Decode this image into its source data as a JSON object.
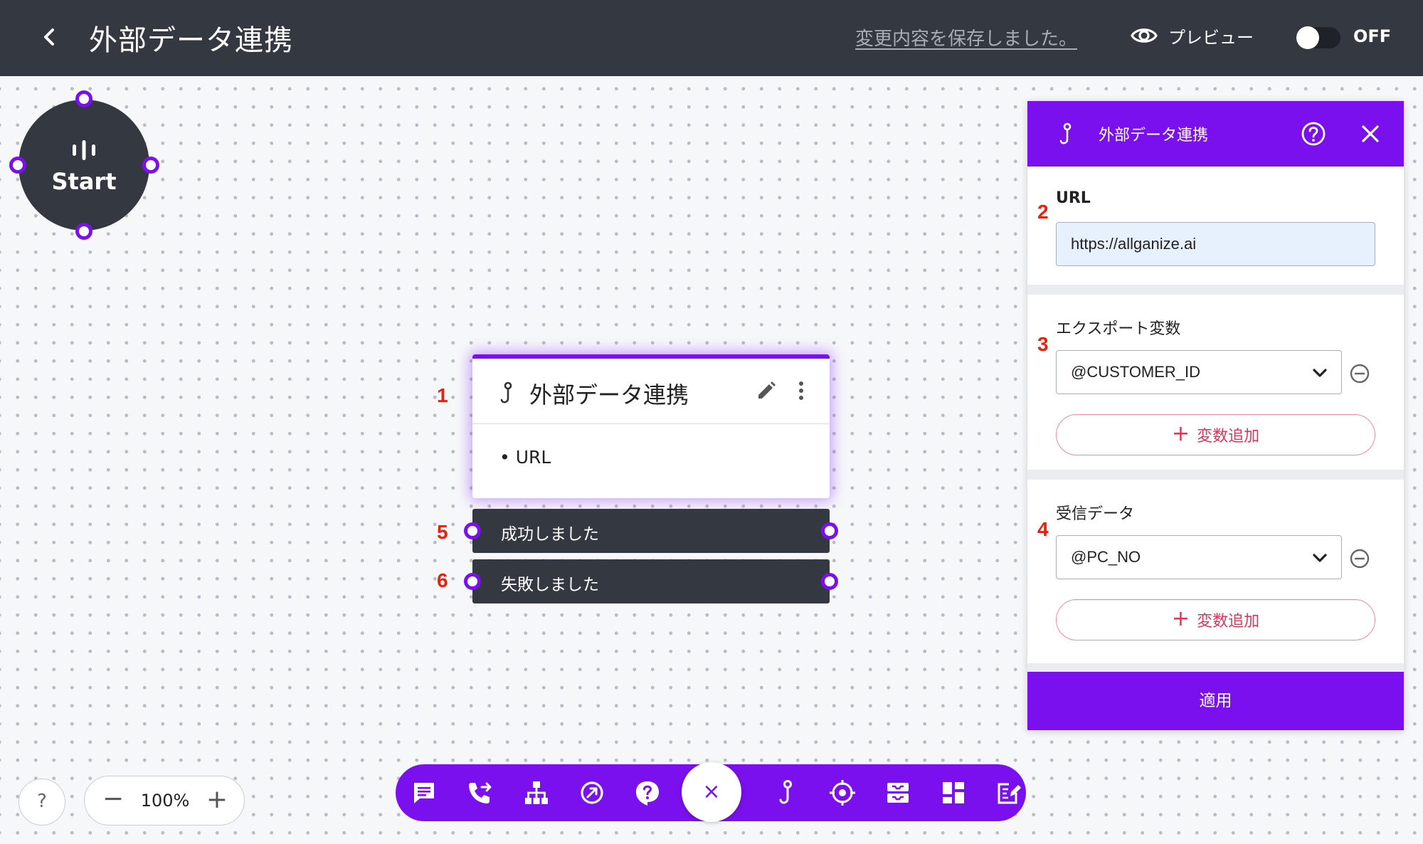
{
  "header": {
    "title": "外部データ連携",
    "save_status": "変更内容を保存しました。",
    "preview_label": "プレビュー",
    "toggle_label": "OFF"
  },
  "canvas": {
    "start_label": "Start",
    "node": {
      "title": "外部データ連携",
      "params": [
        "• URL"
      ]
    },
    "branches": [
      {
        "label": "成功しました",
        "annotation": "5"
      },
      {
        "label": "失敗しました",
        "annotation": "6"
      }
    ],
    "annotations": {
      "node": "1",
      "url": "2",
      "export": "3",
      "receive": "4"
    }
  },
  "panel": {
    "title": "外部データ連携",
    "url_label": "URL",
    "url_value": "https://allganize.ai",
    "export_label": "エクスポート変数",
    "export_value": "@CUSTOMER_ID",
    "receive_label": "受信データ",
    "receive_value": "@PC_NO",
    "add_variable_label": "変数追加",
    "add_variable_plus": "+",
    "apply_label": "適用"
  },
  "bottom": {
    "help": "?",
    "zoom_minus": "−",
    "zoom_level": "100%",
    "zoom_plus": "+",
    "toolbar_close": "×",
    "toolbar_icons": [
      "chat-icon",
      "call-transfer-icon",
      "hierarchy-icon",
      "redirect-icon",
      "faq-icon",
      "webhook-icon",
      "target-icon",
      "inbox-icon",
      "dashboard-icon",
      "form-edit-icon"
    ]
  },
  "colors": {
    "accent": "#7b10ee",
    "header_bg": "#343841",
    "annotation": "#e6210e",
    "add_button": "#e0335a",
    "url_bg": "#e7f0fd"
  }
}
